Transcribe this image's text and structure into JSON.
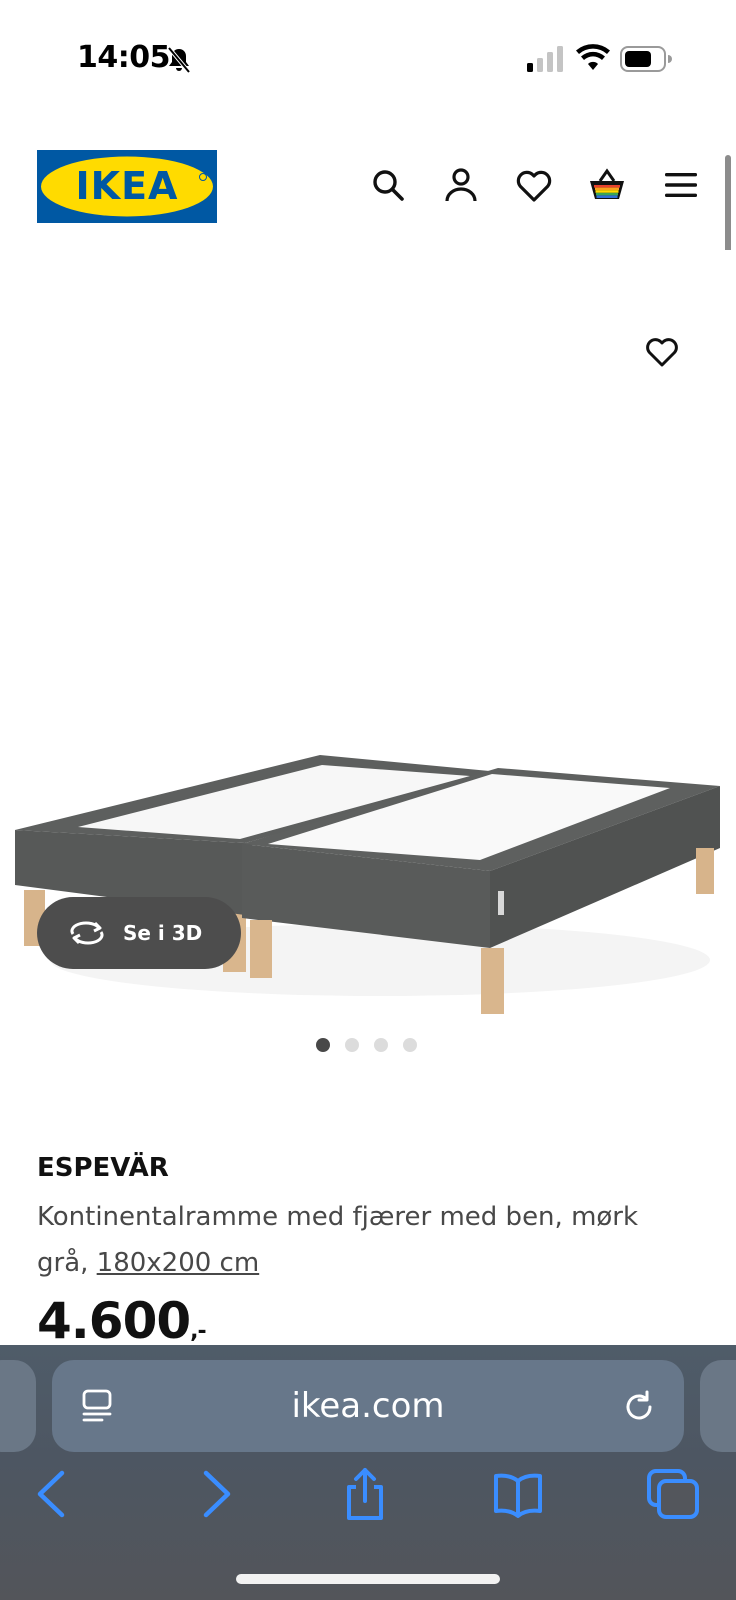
{
  "status_bar": {
    "time": "14:05"
  },
  "header": {
    "logo_text": "IKEA",
    "icons": [
      "search-icon",
      "account-icon",
      "heart-icon",
      "basket-icon",
      "menu-icon"
    ]
  },
  "gallery": {
    "view_3d_label": "Se i 3D",
    "page_count": 4,
    "active_page": 1
  },
  "product": {
    "name": "ESPEVÄR",
    "description_prefix": "Kontinentalramme med fjærer med ben, mørk grå, ",
    "size": "180x200 cm",
    "price": "4.600",
    "price_suffix": ",-"
  },
  "browser": {
    "url": "ikea.com"
  },
  "colors": {
    "ikea_blue": "#0058A3",
    "ikea_yellow": "#FFDB00",
    "button_dark": "#4D4D4D",
    "toolbar_icon_blue": "#3A8DFF"
  }
}
